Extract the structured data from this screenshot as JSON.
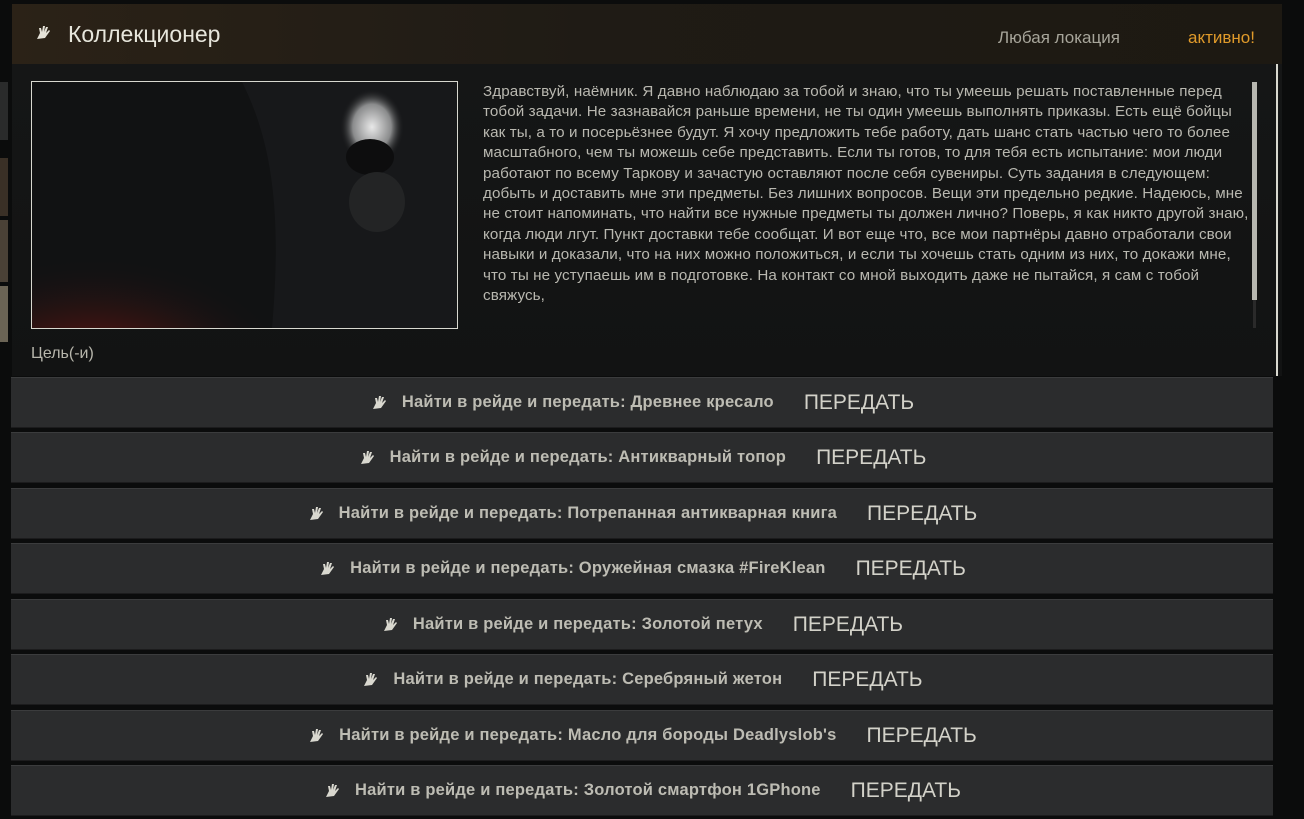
{
  "quest": {
    "title": "Коллекционер",
    "location": "Любая локация",
    "status": "активно!",
    "status_color": "#e09a2a",
    "icon": "hand-icon",
    "description": "Здравствуй, наёмник. Я давно наблюдаю за тобой и знаю, что ты умеешь решать поставленные перед тобой задачи. Не зазнавайся раньше времени, не ты один умеешь выполнять приказы. Есть ещё бойцы как ты, а то и посерьёзнее будут. Я хочу предложить тебе работу, дать шанс стать частью чего то более масштабного, чем ты можешь себе представить. Если ты готов, то для тебя есть испытание: мои люди работают по всему Таркову и зачастую оставляют после себя сувениры. Суть задания в следующем: добыть и доставить мне эти предметы. Без лишних вопросов. Вещи эти предельно редкие. Надеюсь, мне не стоит напоминать, что найти все нужные предметы ты должен лично? Поверь, я как никто другой знаю, когда люди лгут. Пункт доставки тебе сообщат. И вот еще что, все мои партнёры давно отработали свои навыки и доказали, что на них можно положиться, и если ты хочешь стать одним из них, то докажи мне, что ты не уступаешь им в подготовке. На контакт со мной выходить даже не пытайся, я сам с тобой свяжусь,"
  },
  "objectives_label": "Цель(-и)",
  "handover_label": "ПЕРЕДАТЬ",
  "objectives": [
    {
      "text": "Найти в рейде и передать: Древнее кресало"
    },
    {
      "text": "Найти в рейде и передать: Антикварный топор"
    },
    {
      "text": "Найти в рейде и передать: Потрепанная антикварная книга"
    },
    {
      "text": "Найти в рейде и передать: Оружейная смазка #FireKlean"
    },
    {
      "text": "Найти в рейде и передать: Золотой петух"
    },
    {
      "text": "Найти в рейде и передать: Серебряный жетон"
    },
    {
      "text": "Найти в рейде и передать: Масло для бороды Deadlyslob's"
    },
    {
      "text": "Найти в рейде и передать: Золотой смартфон 1GPhone"
    }
  ]
}
